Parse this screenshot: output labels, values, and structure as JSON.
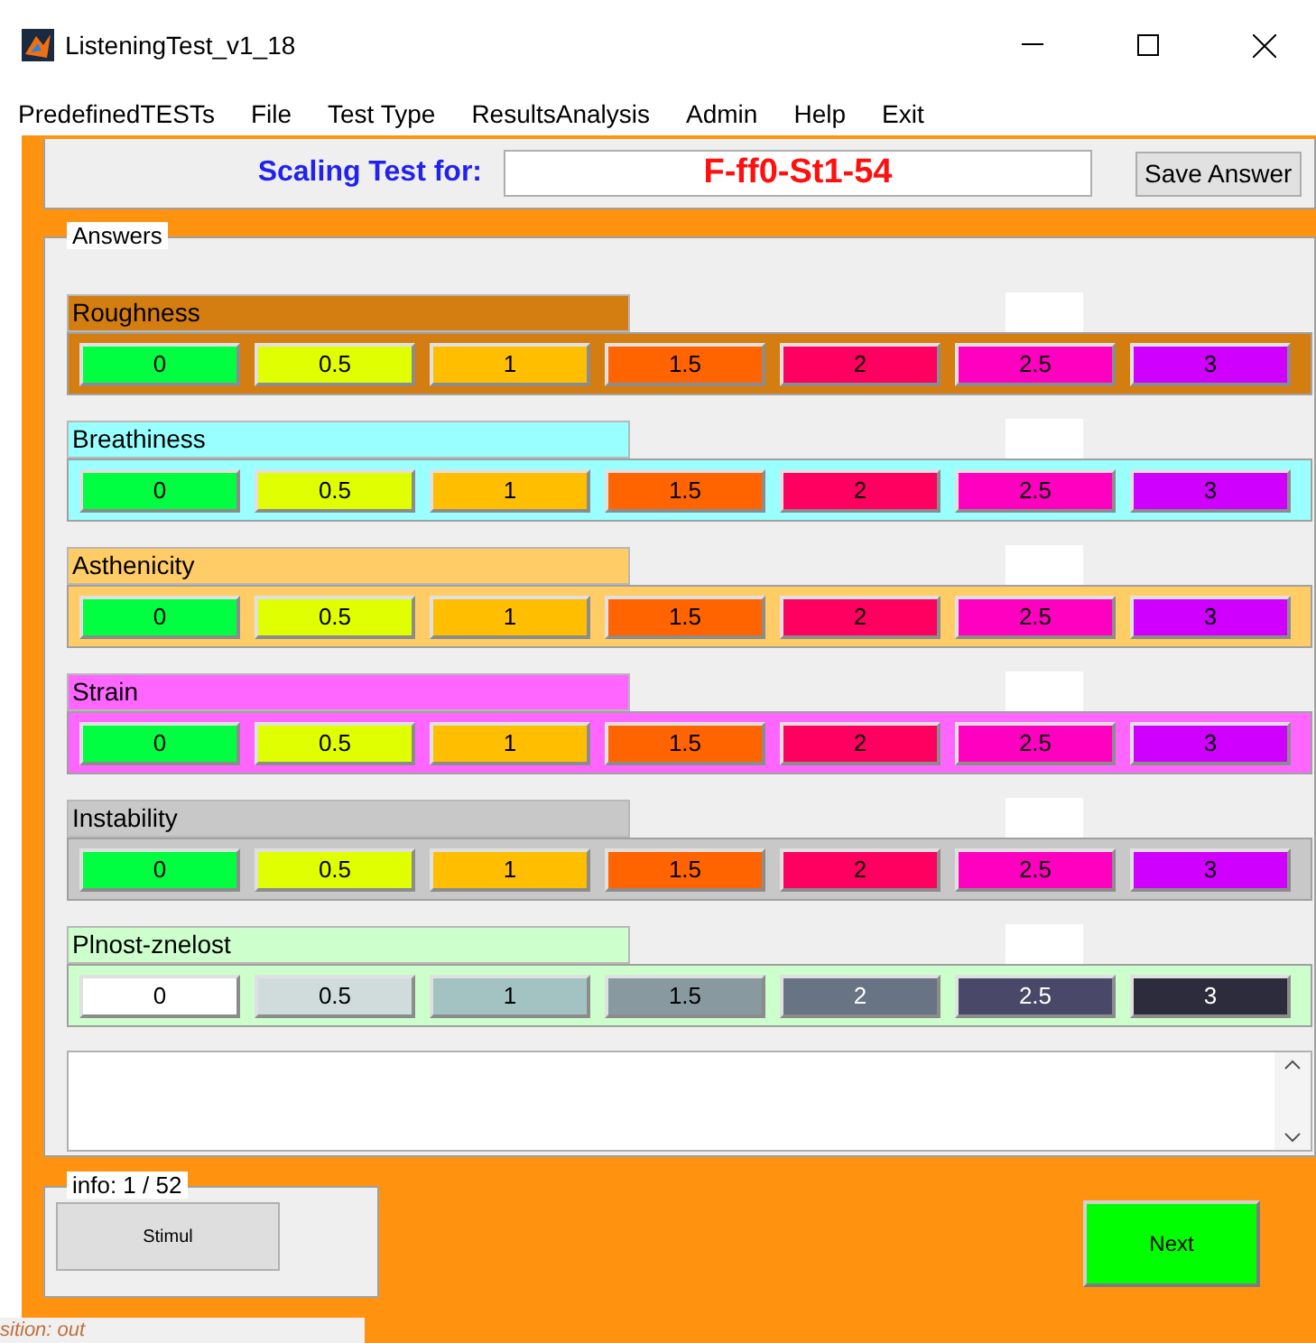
{
  "window": {
    "title": "ListeningTest_v1_18"
  },
  "menu": [
    "PredefinedTESTs",
    "File",
    "Test Type",
    "ResultsAnalysis",
    "Admin",
    "Help",
    "Exit"
  ],
  "general": {
    "label": "Scaling Test for:",
    "stimulus": "F-ff0-St1-54",
    "save_button": "Save Answer"
  },
  "answers": {
    "title": "Answers",
    "scales": [
      {
        "label": "Roughness",
        "color": "#d47d10",
        "options": [
          {
            "label": "0",
            "color": "#00ff40"
          },
          {
            "label": "0.5",
            "color": "#e0ff00"
          },
          {
            "label": "1",
            "color": "#ffbf00"
          },
          {
            "label": "1.5",
            "color": "#ff6400"
          },
          {
            "label": "2",
            "color": "#ff0060"
          },
          {
            "label": "2.5",
            "color": "#ff00c0"
          },
          {
            "label": "3",
            "color": "#d000ff"
          }
        ]
      },
      {
        "label": "Breathiness",
        "color": "#99ffff",
        "options": [
          {
            "label": "0",
            "color": "#00ff40"
          },
          {
            "label": "0.5",
            "color": "#e0ff00"
          },
          {
            "label": "1",
            "color": "#ffbf00"
          },
          {
            "label": "1.5",
            "color": "#ff6400"
          },
          {
            "label": "2",
            "color": "#ff0060"
          },
          {
            "label": "2.5",
            "color": "#ff00c0"
          },
          {
            "label": "3",
            "color": "#d000ff"
          }
        ]
      },
      {
        "label": "Asthenicity",
        "color": "#ffcc66",
        "options": [
          {
            "label": "0",
            "color": "#00ff40"
          },
          {
            "label": "0.5",
            "color": "#e0ff00"
          },
          {
            "label": "1",
            "color": "#ffbf00"
          },
          {
            "label": "1.5",
            "color": "#ff6400"
          },
          {
            "label": "2",
            "color": "#ff0060"
          },
          {
            "label": "2.5",
            "color": "#ff00c0"
          },
          {
            "label": "3",
            "color": "#d000ff"
          }
        ]
      },
      {
        "label": "Strain",
        "color": "#ff66ff",
        "options": [
          {
            "label": "0",
            "color": "#00ff40"
          },
          {
            "label": "0.5",
            "color": "#e0ff00"
          },
          {
            "label": "1",
            "color": "#ffbf00"
          },
          {
            "label": "1.5",
            "color": "#ff6400"
          },
          {
            "label": "2",
            "color": "#ff0060"
          },
          {
            "label": "2.5",
            "color": "#ff00c0"
          },
          {
            "label": "3",
            "color": "#d000ff"
          }
        ]
      },
      {
        "label": "Instability",
        "color": "#c8c8c8",
        "options": [
          {
            "label": "0",
            "color": "#00ff40"
          },
          {
            "label": "0.5",
            "color": "#e0ff00"
          },
          {
            "label": "1",
            "color": "#ffbf00"
          },
          {
            "label": "1.5",
            "color": "#ff6400"
          },
          {
            "label": "2",
            "color": "#ff0060"
          },
          {
            "label": "2.5",
            "color": "#ff00c0"
          },
          {
            "label": "3",
            "color": "#d000ff"
          }
        ]
      },
      {
        "label": "Plnost-znelost",
        "color": "#ccffcc",
        "options": [
          {
            "label": "0",
            "color": "#ffffff"
          },
          {
            "label": "0.5",
            "color": "#d0dcdc"
          },
          {
            "label": "1",
            "color": "#a3c2c2"
          },
          {
            "label": "1.5",
            "color": "#8899a0"
          },
          {
            "label": "2",
            "color": "#687384"
          },
          {
            "label": "2.5",
            "color": "#4a4868"
          },
          {
            "label": "3",
            "color": "#2c2c3c"
          }
        ]
      }
    ]
  },
  "info": {
    "title": "info: 1 / 52",
    "stimulus_button": "Stimul"
  },
  "next_button": "Next",
  "status": "sition: out"
}
